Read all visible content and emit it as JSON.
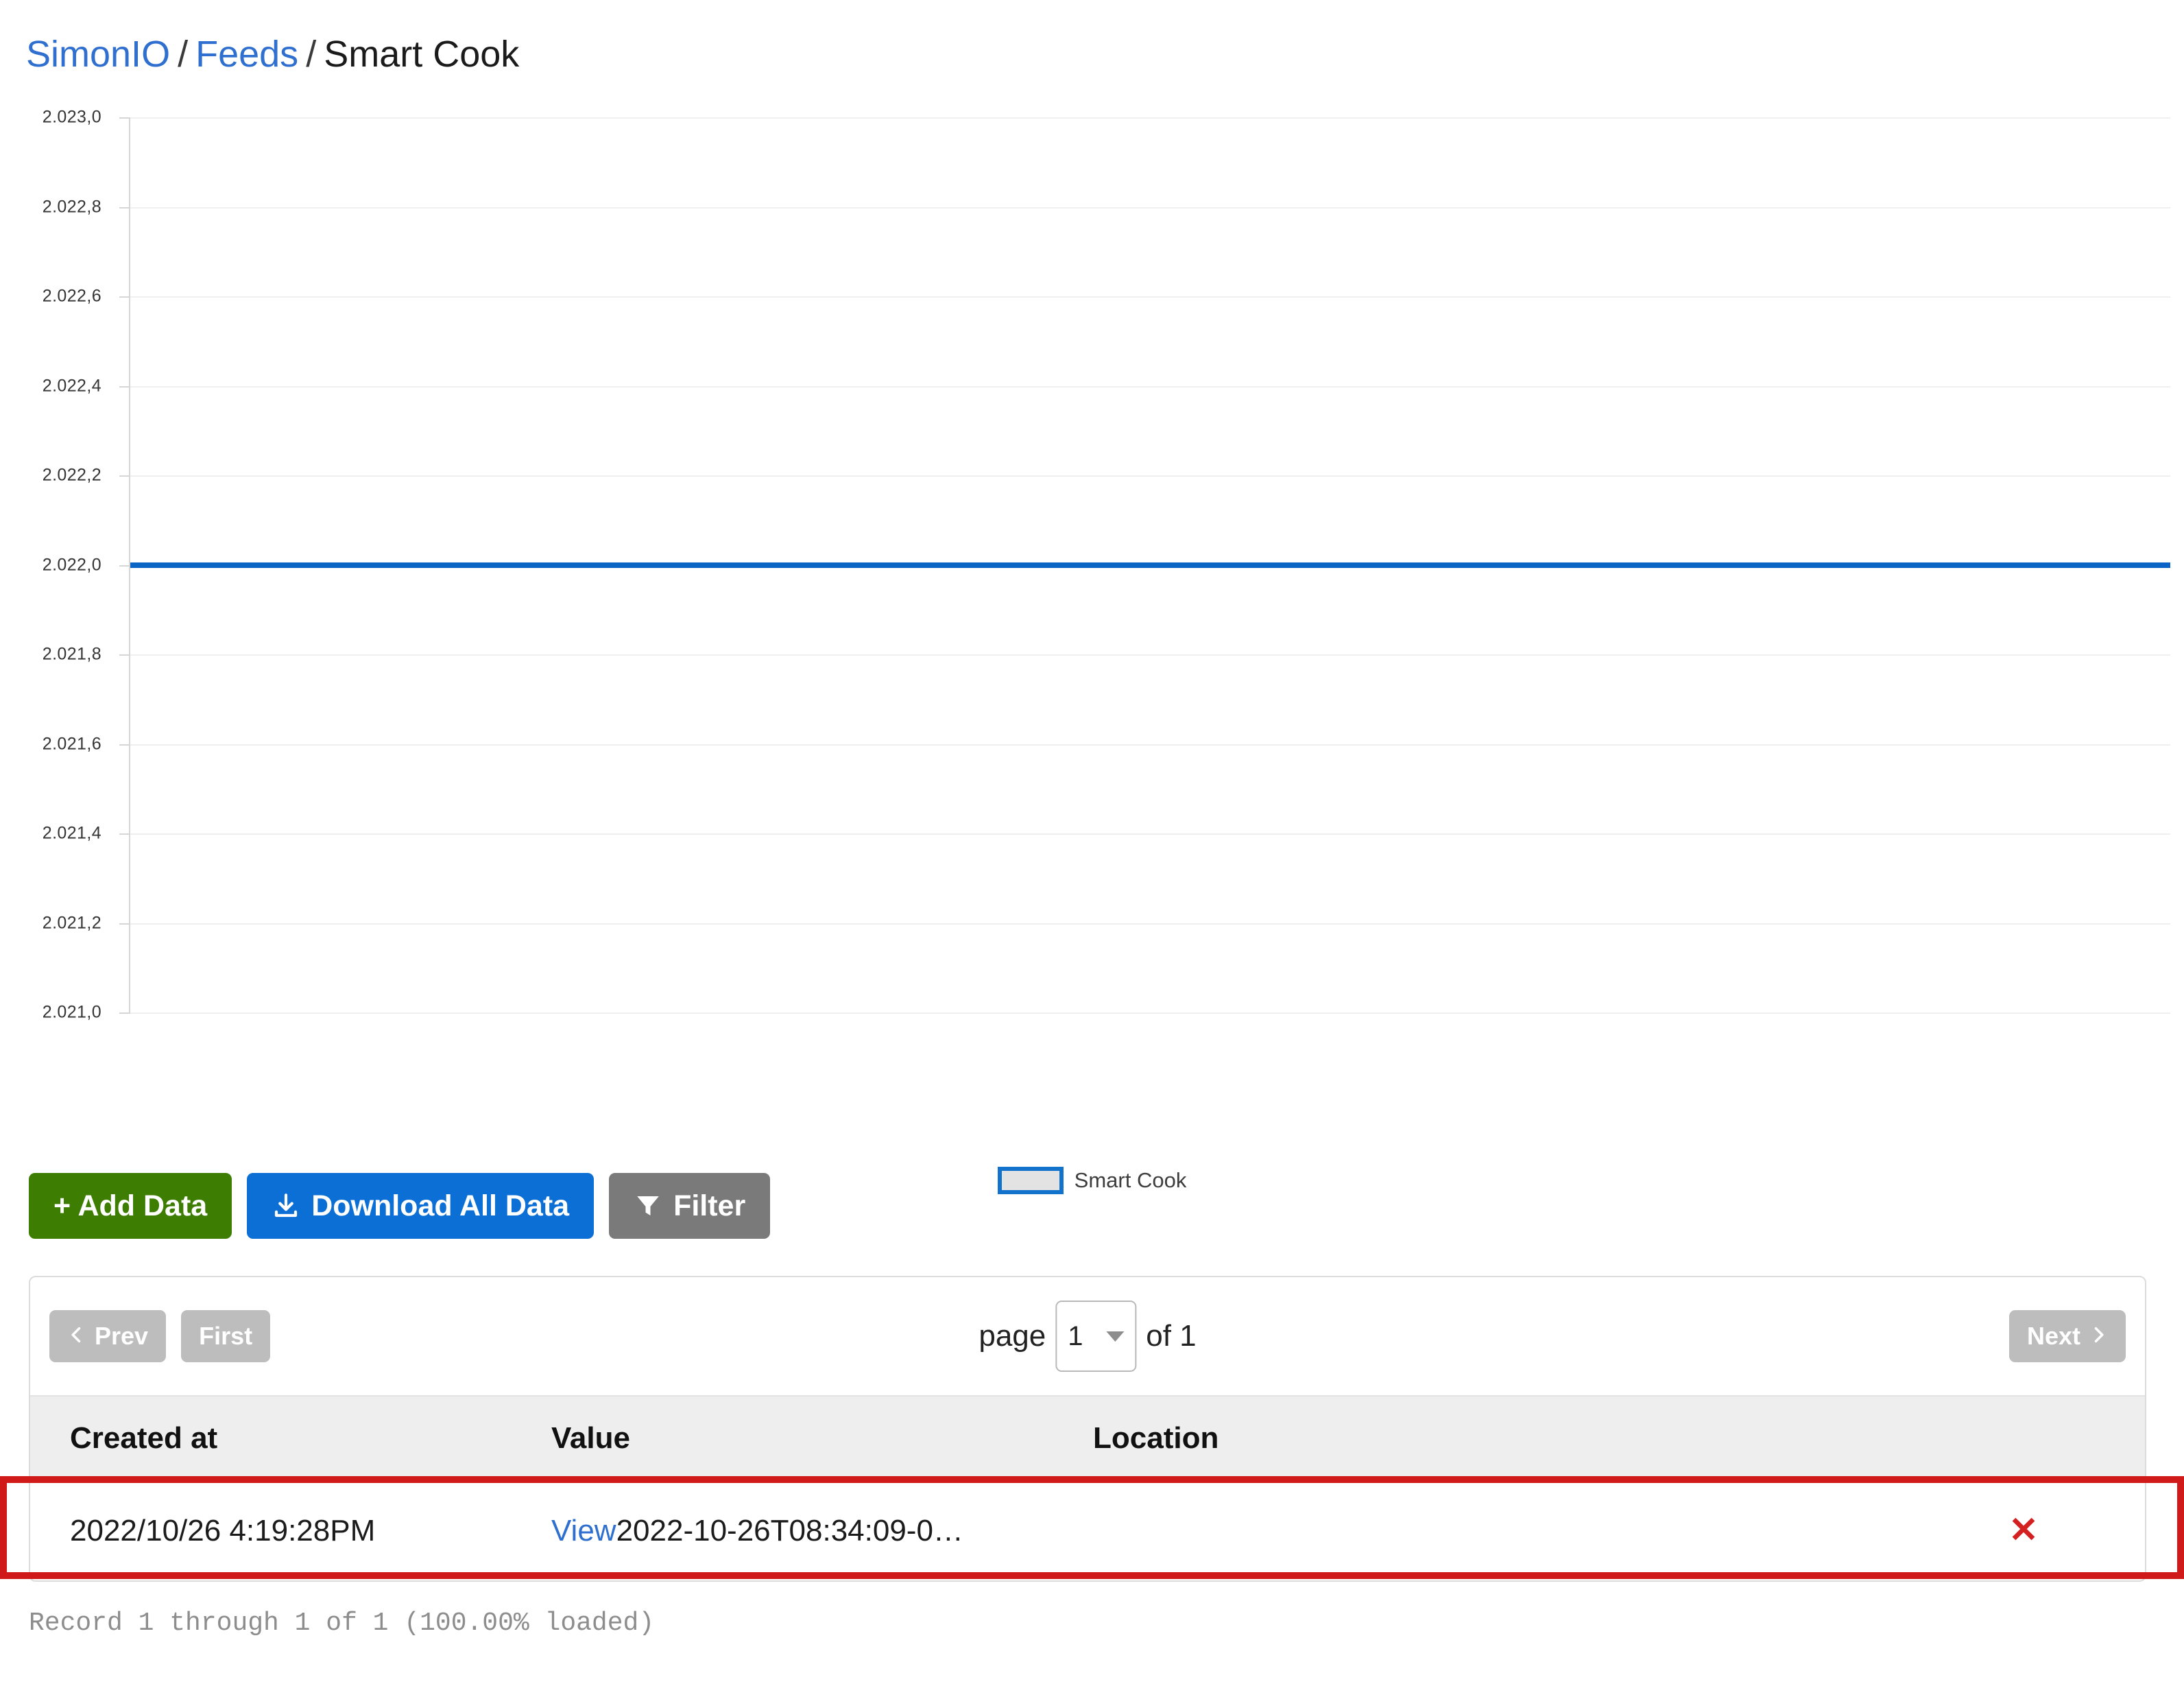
{
  "breadcrumb": {
    "root": "SimonIO",
    "section": "Feeds",
    "current": "Smart Cook",
    "separator": "/"
  },
  "chart_data": {
    "type": "line",
    "title": "",
    "xlabel": "",
    "ylabel": "",
    "ylim": [
      2021.0,
      2023.0
    ],
    "grid": true,
    "legend_position": "bottom-center",
    "tick_labels": [
      "2.023,0",
      "2.022,8",
      "2.022,6",
      "2.022,4",
      "2.022,2",
      "2.022,0",
      "2.021,8",
      "2.021,6",
      "2.021,4",
      "2.021,2",
      "2.021,0"
    ],
    "tick_values": [
      2023.0,
      2022.8,
      2022.6,
      2022.4,
      2022.2,
      2022.0,
      2021.8,
      2021.6,
      2021.4,
      2021.2,
      2021.0
    ],
    "series": [
      {
        "name": "Smart Cook",
        "color": "#0b63c5",
        "values": [
          2022.0,
          2022.0
        ]
      }
    ],
    "legend": [
      "Smart Cook"
    ]
  },
  "legend": {
    "label": "Smart Cook",
    "swatch_border": "#1272cc",
    "swatch_fill": "#e3e3e3"
  },
  "toolbar": {
    "add_label": "+ Add Data",
    "download_label": "Download All Data",
    "filter_label": "Filter",
    "add_color": "#3c7d02",
    "download_color": "#0b6fd6",
    "filter_color": "#7a7a7a"
  },
  "pager": {
    "prev_label": "Prev",
    "first_label": "First",
    "next_label": "Next",
    "page_word": "page",
    "page_value": "1",
    "of_text": "of 1"
  },
  "table": {
    "columns": [
      "Created at",
      "Value",
      "Location"
    ],
    "rows": [
      {
        "created_at": "2022/10/26 4:19:28PM",
        "value_link": "View",
        "value_text": "2022-10-26T08:34:09-0…",
        "location": "",
        "delete_icon": "✕"
      }
    ]
  },
  "footer": {
    "status": "Record 1 through 1 of 1 (100.00% loaded)"
  },
  "annotation": {
    "highlight_color": "#d01919"
  }
}
